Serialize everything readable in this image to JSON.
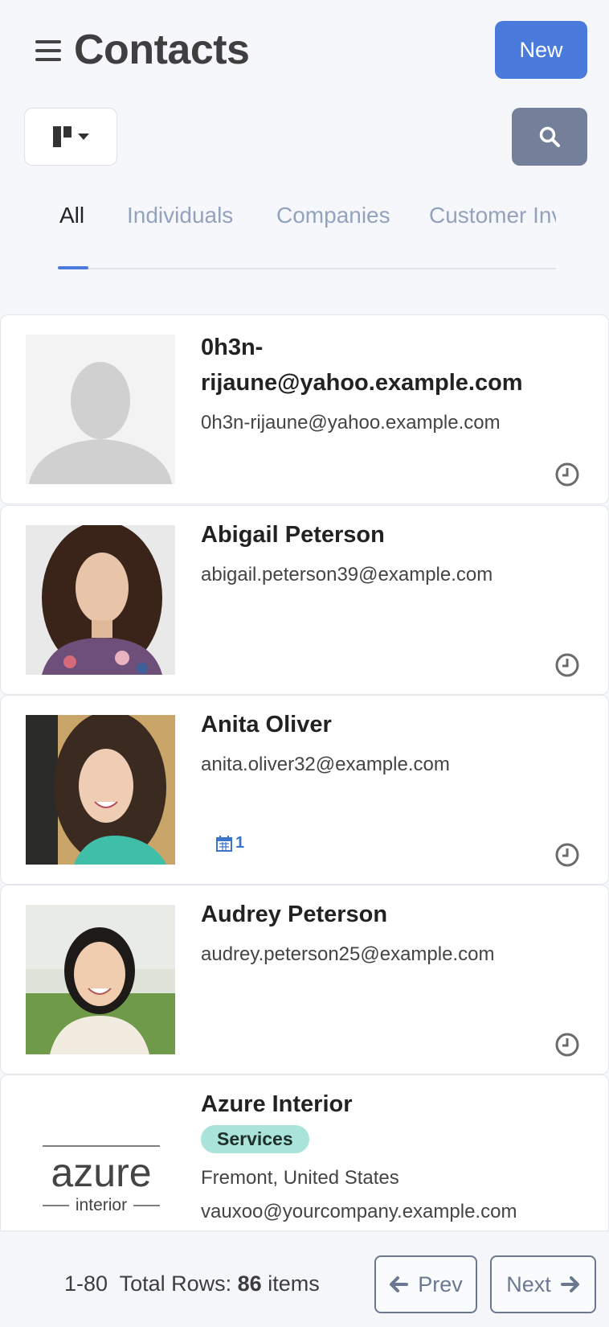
{
  "header": {
    "title": "Contacts",
    "new_label": "New"
  },
  "tabs": [
    {
      "label": "All",
      "active": true
    },
    {
      "label": "Individuals",
      "active": false
    },
    {
      "label": "Companies",
      "active": false
    },
    {
      "label": "Customer Inv",
      "active": false
    }
  ],
  "contacts": [
    {
      "name_line1": "0h3n-",
      "name_line2": "rijaune@yahoo.example.com",
      "email": "0h3n-rijaune@yahoo.example.com",
      "photo": "placeholder-avatar"
    },
    {
      "name": "Abigail Peterson",
      "email": "abigail.peterson39@example.com",
      "photo": "woman-curly-hair"
    },
    {
      "name": "Anita Oliver",
      "email": "anita.oliver32@example.com",
      "photo": "woman-dark-hair",
      "activity_count": "1"
    },
    {
      "name": "Audrey Peterson",
      "email": "audrey.peterson25@example.com",
      "photo": "woman-smiling-park"
    },
    {
      "name": "Azure Interior",
      "tag": "Services",
      "location": "Fremont, United States",
      "email": "vauxoo@yourcompany.example.com",
      "photo": "azure-logo",
      "logo_text": "azure",
      "logo_subtext": "interior"
    }
  ],
  "pager": {
    "range": "1-80",
    "total_label": "Total Rows:",
    "total_count": "86",
    "items_label": "items",
    "prev_label": "Prev",
    "next_label": "Next"
  },
  "colors": {
    "primary": "#4a7bdc",
    "search_button": "#74809a",
    "tag_bg": "#a9e3d9",
    "tab_inactive": "#93a3bd"
  },
  "icons": [
    "hamburger-icon",
    "kanban-view-icon",
    "caret-down-icon",
    "search-icon",
    "clock-icon",
    "calendar-icon",
    "arrow-left-icon",
    "arrow-right-icon"
  ]
}
